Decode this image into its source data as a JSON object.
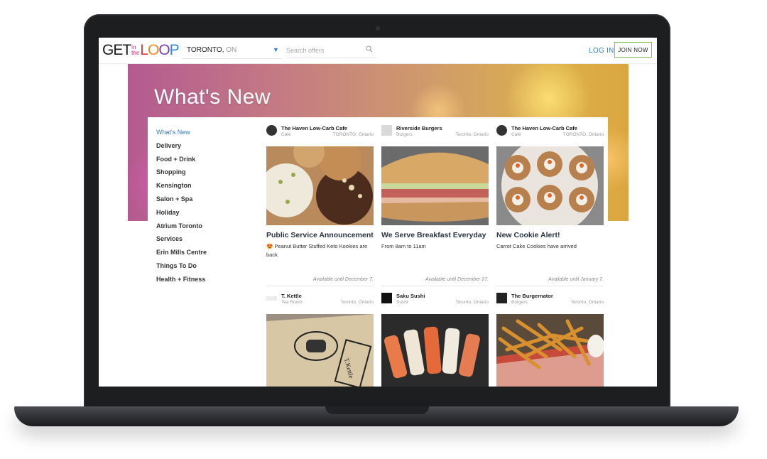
{
  "nav": {
    "logo": {
      "get": "GET",
      "in": "in",
      "the": "the",
      "loop": [
        "L",
        "O",
        "O",
        "P"
      ]
    },
    "city": "TORONTO,",
    "province": "ON",
    "search_placeholder": "Search offers",
    "login": "LOG IN",
    "join": "JOIN NOW"
  },
  "hero": {
    "title": "What's New"
  },
  "sidebar": {
    "items": [
      {
        "label": "What's New",
        "active": true
      },
      {
        "label": "Delivery"
      },
      {
        "label": "Food + Drink"
      },
      {
        "label": "Shopping"
      },
      {
        "label": "Kensington"
      },
      {
        "label": "Salon + Spa"
      },
      {
        "label": "Holiday"
      },
      {
        "label": "Atrium Toronto"
      },
      {
        "label": "Services"
      },
      {
        "label": "Erin Mills Centre"
      },
      {
        "label": "Things To Do"
      },
      {
        "label": "Health + Fitness"
      }
    ]
  },
  "cards": [
    {
      "business": "The Haven Low-Carb Cafe",
      "category": "Café",
      "location": "TORONTO, Ontario",
      "title": "Public Service Announcement",
      "subtitle": "😍 Peanut Butter Stuffed Keto Kookies are back",
      "available": "Available until December 7.",
      "image": "cookies"
    },
    {
      "business": "Riverside Burgers",
      "category": "Burgers",
      "location": "Toronto, Ontario",
      "title": "We Serve Breakfast Everyday",
      "subtitle": "From 8am to 11am",
      "available": "Available until December 27.",
      "image": "sandwich"
    },
    {
      "business": "The Haven Low-Carb Cafe",
      "category": "Café",
      "location": "TORONTO, Ontario",
      "title": "New Cookie Alert!",
      "subtitle": "Carrot Cake Cookies have arrived",
      "available": "Available until January 7.",
      "image": "carrot-cookies"
    },
    {
      "business": "T. Kettle",
      "category": "Tea Room",
      "location": "Toronto, Ontario",
      "image": "tote-bag",
      "stripe": "#9b3bbf"
    },
    {
      "business": "Saku Sushi",
      "category": "Sushi",
      "location": "Toronto, Ontario",
      "image": "sushi",
      "stripe": "#9b3bbf"
    },
    {
      "business": "The Burgernator",
      "category": "Burgers",
      "location": "Toronto, Ontario",
      "image": "fries",
      "stripe": "#2b7fd0"
    }
  ],
  "colors": {
    "accent": "#2b7fd0",
    "join_border": "#7cc04b",
    "title_text": "#2a3444"
  }
}
